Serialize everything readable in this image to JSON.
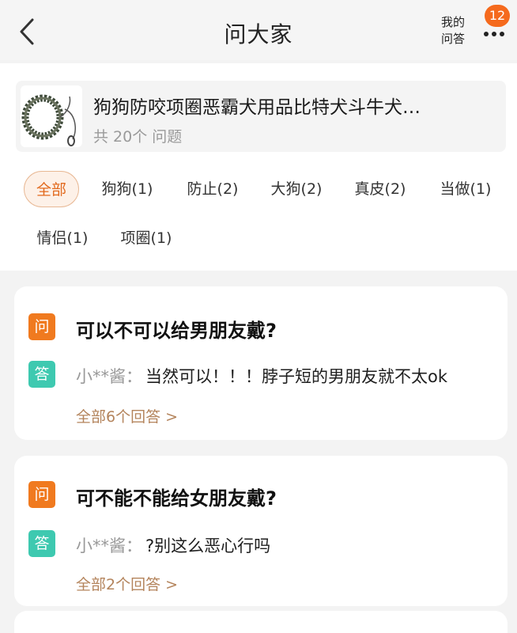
{
  "header": {
    "title": "问大家",
    "my_qa_line1": "我的",
    "my_qa_line2": "问答",
    "badge_count": "12"
  },
  "product": {
    "title": "狗狗防咬项圈恶霸犬用品比特犬斗牛犬…",
    "question_count": "共 20个 问题"
  },
  "tags": [
    {
      "label": "全部",
      "active": true
    },
    {
      "label": "狗狗(1)"
    },
    {
      "label": "防止(2)"
    },
    {
      "label": "大狗(2)"
    },
    {
      "label": "真皮(2)"
    },
    {
      "label": "当做(1)"
    },
    {
      "label": "情侣(1)"
    },
    {
      "label": "项圈(1)"
    }
  ],
  "qa": [
    {
      "q_badge": "问",
      "question": "可以不可以给男朋友戴?",
      "a_badge": "答",
      "answer_user": "小**酱：",
      "answer": "当然可以！！！脖子短的男朋友就不太ok",
      "all_answers": "全部6个回答 >"
    },
    {
      "q_badge": "问",
      "question": "可不能不能给女朋友戴?",
      "a_badge": "答",
      "answer_user": "小**酱：",
      "answer": "?别这么恶心行吗",
      "all_answers": "全部2个回答 >"
    }
  ],
  "icons": {
    "back": "chevron-left-icon",
    "more": "more-dots-icon"
  },
  "colors": {
    "accent": "#f07a1f",
    "answer": "#3ec9b0",
    "badge": "#f56a1d",
    "link": "#b4845c"
  }
}
